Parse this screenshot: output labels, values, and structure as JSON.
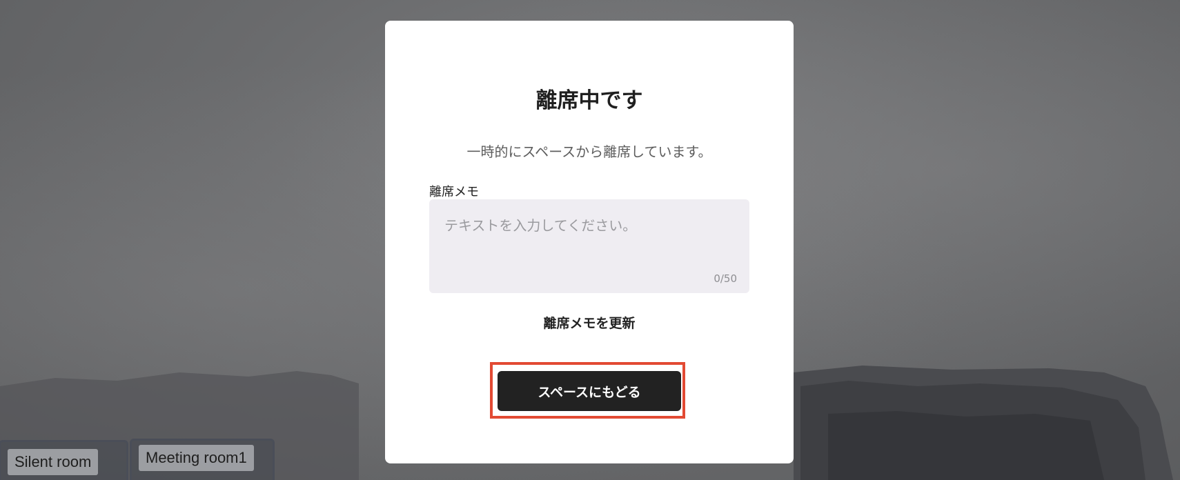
{
  "modal": {
    "title": "離席中です",
    "description": "一時的にスペースから離席しています。",
    "memo_label": "離席メモ",
    "memo_placeholder": "テキストを入力してください。",
    "memo_value": "",
    "memo_counter": "0/50",
    "update_memo_label": "離席メモを更新",
    "return_button_label": "スペースにもどる"
  },
  "rooms": [
    {
      "label": "Silent room"
    },
    {
      "label": "Meeting room1"
    }
  ],
  "colors": {
    "modal_background": "#ffffff",
    "memo_box_background": "#efedf2",
    "button_background": "#222222",
    "highlight_border": "#e24a33"
  }
}
